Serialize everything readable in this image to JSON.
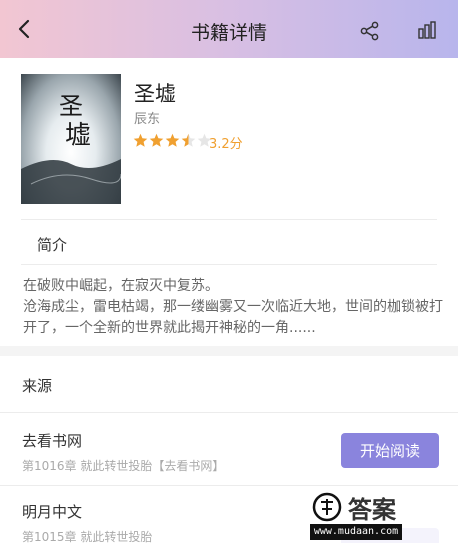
{
  "header": {
    "title": "书籍详情",
    "back_icon": "chevron-left-icon",
    "share_icon": "share-icon",
    "stats_icon": "bar-chart-icon"
  },
  "book": {
    "title": "圣墟",
    "author": "辰东",
    "rating": 3.5,
    "rating_max": 5,
    "score_text": "3.2分",
    "cover_title": "圣墟"
  },
  "intro": {
    "label": "简介",
    "lines": [
      "在破败中崛起，在寂灭中复苏。",
      " 沧海成尘，雷电枯竭，那一缕幽雾又一次临近大地，世间的枷锁被打开了，一个全新的世界就此揭开神秘的一角......"
    ]
  },
  "sources": {
    "label": "来源",
    "items": [
      {
        "name": "去看书网",
        "chapter": "第1016章 就此转世投胎【去看书网】"
      },
      {
        "name": "明月中文",
        "chapter": "第1015章 就此转世投胎"
      }
    ],
    "read_button": "开始阅读"
  },
  "watermark": {
    "text": "答案",
    "url": "www.mudaan.com"
  },
  "colors": {
    "accent": "#8a84dd",
    "star": "#f0a030",
    "header_left": "#f2c6d2",
    "header_right": "#b8b5ec"
  }
}
